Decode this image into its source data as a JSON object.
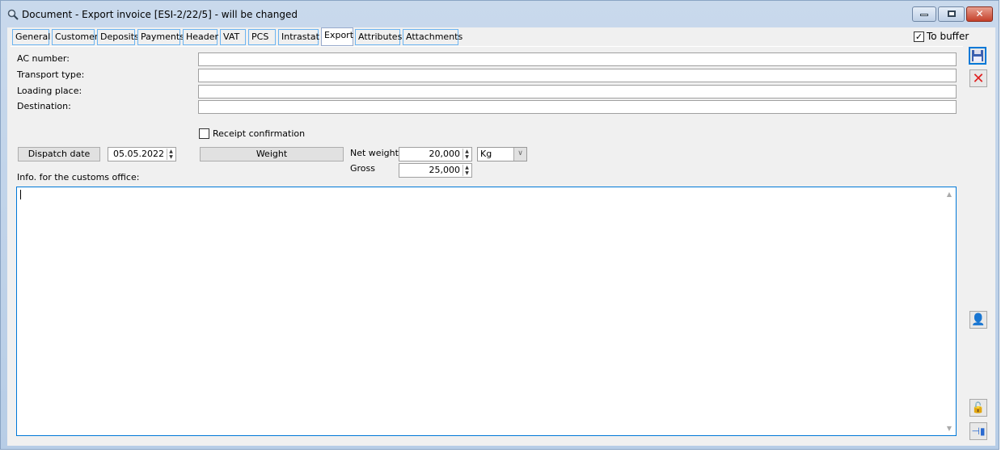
{
  "window": {
    "title": "Document - Export invoice [ESI-2/22/5]  - will be changed"
  },
  "tabs": [
    "General",
    "Customer",
    "Deposits",
    "Payments",
    "Header",
    "VAT",
    "PCS",
    "Intrastat",
    "Export",
    "Attributes",
    "Attachments"
  ],
  "active_tab": "Export",
  "to_buffer": {
    "label": "To buffer",
    "checked": true
  },
  "fields": {
    "ac_number": {
      "label": "AC number:",
      "value": ""
    },
    "transport_type": {
      "label": "Transport type:",
      "value": ""
    },
    "loading_place": {
      "label": "Loading place:",
      "value": ""
    },
    "destination": {
      "label": "Destination:",
      "value": ""
    }
  },
  "receipt_confirmation": {
    "label": "Receipt confirmation",
    "checked": false
  },
  "dispatch": {
    "button": "Dispatch date",
    "value": "05.05.2022"
  },
  "weight": {
    "button": "Weight",
    "net_label": "Net weight",
    "net_value": "20,000",
    "gross_label": "Gross",
    "gross_value": "25,000",
    "unit": "Kg"
  },
  "customs": {
    "label": "Info. for the customs office:",
    "value": ""
  }
}
